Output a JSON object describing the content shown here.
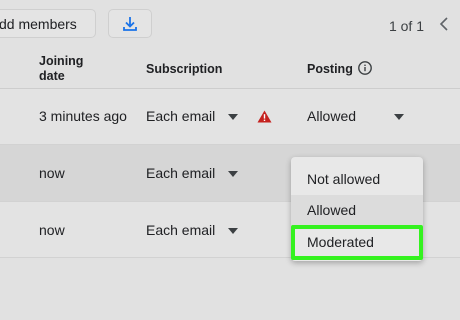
{
  "toolbar": {
    "add_members_label": "dd members",
    "download_icon": "download-icon"
  },
  "pagination": {
    "text": "1 of 1",
    "prev_icon": "chevron-left-icon"
  },
  "table": {
    "headers": {
      "joining_date": "Joining date",
      "subscription": "Subscription",
      "posting": "Posting",
      "posting_info_icon": "info-icon"
    },
    "rows": [
      {
        "joined": "3 minutes ago",
        "subscription": "Each email",
        "posting": "Allowed",
        "warning": true
      },
      {
        "joined": "now",
        "subscription": "Each email",
        "posting": ""
      },
      {
        "joined": "now",
        "subscription": "Each email",
        "posting": ""
      }
    ]
  },
  "posting_dropdown": {
    "options": [
      "Not allowed",
      "Allowed",
      "Moderated"
    ],
    "selected": "Allowed",
    "highlighted": "Moderated"
  },
  "colors": {
    "highlight_outline": "#34f21f",
    "warning": "#c5221f"
  }
}
